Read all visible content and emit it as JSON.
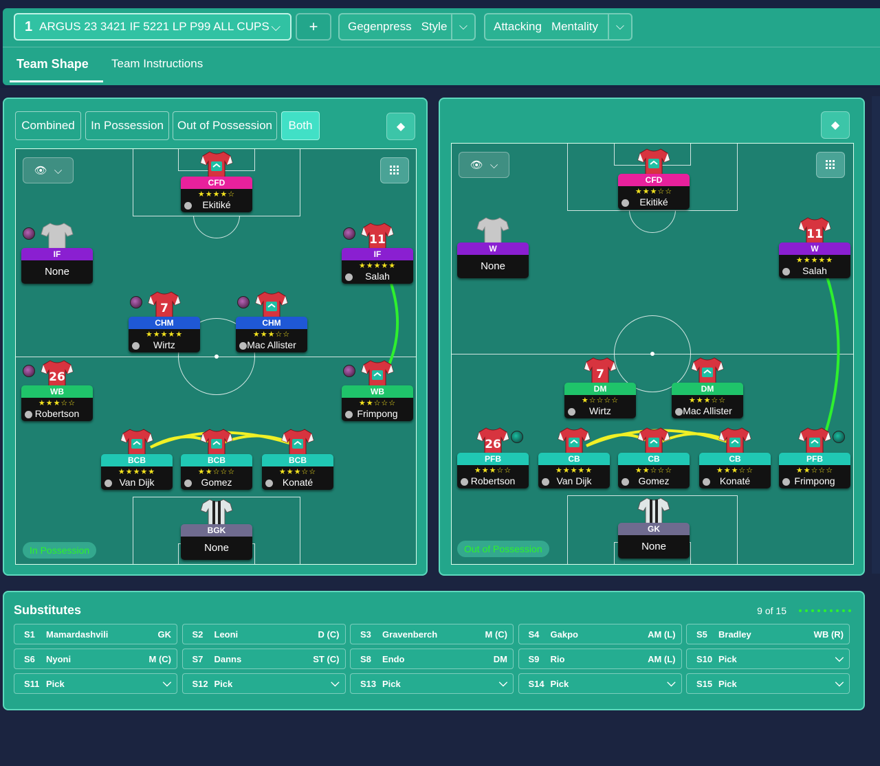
{
  "tactic": {
    "number": "1",
    "name": "ARGUS 23 3421 IF 5221 LP P99 ALL CUPS",
    "add_label": "+"
  },
  "style": {
    "value": "Gegenpress",
    "label": "Style"
  },
  "mentality": {
    "value": "Attacking",
    "label": "Mentality"
  },
  "tabs": {
    "team_shape": "Team Shape",
    "team_instructions": "Team Instructions"
  },
  "filters": {
    "combined": "Combined",
    "in_possession": "In Possession",
    "out_of_possession": "Out of Possession",
    "both": "Both"
  },
  "pitch_labels": {
    "in": "In Possession",
    "out": "Out of Possession"
  },
  "colors": {
    "panel": "#23a68b",
    "pink": "#e8219c",
    "purple": "#8a1fd1",
    "blue": "#1f58d6",
    "green": "#1fc46a",
    "teal": "#20c8b4",
    "grey": "#6f6b8f",
    "links": "#f0f026"
  },
  "in_possession": [
    {
      "role": "CFD",
      "stars": "★★★★☆",
      "name": "Ekitiké",
      "color": "pink",
      "shirt": "red-badge"
    },
    {
      "role": "IF",
      "stars": "",
      "name": "None",
      "color": "purple",
      "shirt": "grey"
    },
    {
      "role": "IF",
      "stars": "★★★★★",
      "name": "Salah",
      "color": "purple",
      "shirt": "red-11"
    },
    {
      "role": "CHM",
      "stars": "★★★★★",
      "name": "Wirtz",
      "color": "blue",
      "shirt": "red-7"
    },
    {
      "role": "CHM",
      "stars": "★★★☆☆",
      "name": "Mac Allister",
      "color": "blue",
      "shirt": "red-badge"
    },
    {
      "role": "WB",
      "stars": "★★★☆☆",
      "name": "Robertson",
      "color": "green",
      "shirt": "red-26"
    },
    {
      "role": "WB",
      "stars": "★★☆☆☆",
      "name": "Frimpong",
      "color": "green",
      "shirt": "red-badge"
    },
    {
      "role": "BCB",
      "stars": "★★★★★",
      "name": "Van Dijk",
      "color": "teal",
      "shirt": "red-badge"
    },
    {
      "role": "BCB",
      "stars": "★★☆☆☆",
      "name": "Gomez",
      "color": "teal",
      "shirt": "red-badge"
    },
    {
      "role": "BCB",
      "stars": "★★★☆☆",
      "name": "Konaté",
      "color": "teal",
      "shirt": "red-badge"
    },
    {
      "role": "BGK",
      "stars": "",
      "name": "None",
      "color": "grey",
      "shirt": "gk"
    }
  ],
  "out_of_possession": [
    {
      "role": "CFD",
      "stars": "★★★☆☆",
      "name": "Ekitiké",
      "color": "pink",
      "shirt": "red-badge"
    },
    {
      "role": "W",
      "stars": "",
      "name": "None",
      "color": "purple",
      "shirt": "grey"
    },
    {
      "role": "W",
      "stars": "★★★★★",
      "name": "Salah",
      "color": "purple",
      "shirt": "red-11"
    },
    {
      "role": "DM",
      "stars": "★☆☆☆☆",
      "name": "Wirtz",
      "color": "green",
      "shirt": "red-7"
    },
    {
      "role": "DM",
      "stars": "★★★☆☆",
      "name": "Mac Allister",
      "color": "green",
      "shirt": "red-badge"
    },
    {
      "role": "PFB",
      "stars": "★★★☆☆",
      "name": "Robertson",
      "color": "teal",
      "shirt": "red-26"
    },
    {
      "role": "CB",
      "stars": "★★★★★",
      "name": "Van Dijk",
      "color": "teal",
      "shirt": "red-badge"
    },
    {
      "role": "CB",
      "stars": "★★☆☆☆",
      "name": "Gomez",
      "color": "teal",
      "shirt": "red-badge"
    },
    {
      "role": "CB",
      "stars": "★★★☆☆",
      "name": "Konaté",
      "color": "teal",
      "shirt": "red-badge"
    },
    {
      "role": "PFB",
      "stars": "★★☆☆☆",
      "name": "Frimpong",
      "color": "teal",
      "shirt": "red-badge"
    },
    {
      "role": "GK",
      "stars": "",
      "name": "None",
      "color": "grey",
      "shirt": "gk"
    }
  ],
  "substitutes": {
    "title": "Substitutes",
    "count": "9 of 15",
    "slots": [
      {
        "slot": "S1",
        "name": "Mamardashvili",
        "pos": "GK"
      },
      {
        "slot": "S2",
        "name": "Leoni",
        "pos": "D (C)"
      },
      {
        "slot": "S3",
        "name": "Gravenberch",
        "pos": "M (C)"
      },
      {
        "slot": "S4",
        "name": "Gakpo",
        "pos": "AM (L)"
      },
      {
        "slot": "S5",
        "name": "Bradley",
        "pos": "WB (R)"
      },
      {
        "slot": "S6",
        "name": "Nyoni",
        "pos": "M (C)"
      },
      {
        "slot": "S7",
        "name": "Danns",
        "pos": "ST (C)"
      },
      {
        "slot": "S8",
        "name": "Endo",
        "pos": "DM"
      },
      {
        "slot": "S9",
        "name": "Rio",
        "pos": "AM (L)"
      },
      {
        "slot": "S10",
        "name": "Pick",
        "pos": ""
      },
      {
        "slot": "S11",
        "name": "Pick",
        "pos": ""
      },
      {
        "slot": "S12",
        "name": "Pick",
        "pos": ""
      },
      {
        "slot": "S13",
        "name": "Pick",
        "pos": ""
      },
      {
        "slot": "S14",
        "name": "Pick",
        "pos": ""
      },
      {
        "slot": "S15",
        "name": "Pick",
        "pos": ""
      }
    ]
  }
}
